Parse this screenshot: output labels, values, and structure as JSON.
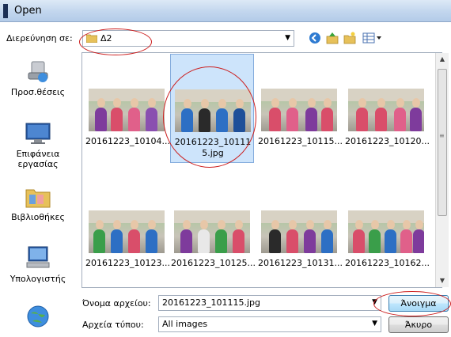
{
  "window": {
    "title": "Open"
  },
  "look_in": {
    "label": "Διερεύνηση σε:",
    "folder": "Δ2"
  },
  "toolbar": {
    "icons": [
      "back-icon",
      "up-folder-icon",
      "new-folder-icon",
      "view-menu-icon"
    ]
  },
  "places": [
    {
      "label": "Προσ.θέσεις",
      "icon": "recent-places-icon"
    },
    {
      "label": "Επιφάνεια εργασίας",
      "icon": "desktop-icon"
    },
    {
      "label": "Βιβλιοθήκες",
      "icon": "libraries-icon"
    },
    {
      "label": "Υπολογιστής",
      "icon": "computer-icon"
    },
    {
      "label": "",
      "icon": "network-icon"
    }
  ],
  "files": [
    {
      "name": "20161223_10104..."
    },
    {
      "name": "20161223_101115.jpg",
      "selected": true
    },
    {
      "name": "20161223_10115..."
    },
    {
      "name": "20161223_10120..."
    },
    {
      "name": "20161223_10123..."
    },
    {
      "name": "20161223_10125..."
    },
    {
      "name": "20161223_10131..."
    },
    {
      "name": "20161223_10162..."
    }
  ],
  "filename": {
    "label": "Όνομα αρχείου:",
    "value": "20161223_101115.jpg"
  },
  "filetype": {
    "label": "Αρχεία τύπου:",
    "value": "All images"
  },
  "buttons": {
    "open": "Άνοιγμα",
    "cancel": "Άκυρο"
  },
  "colors": {
    "annotation": "#cc1f1f",
    "selection": "#cde4fb",
    "title_bar": "#c2d6ee"
  }
}
